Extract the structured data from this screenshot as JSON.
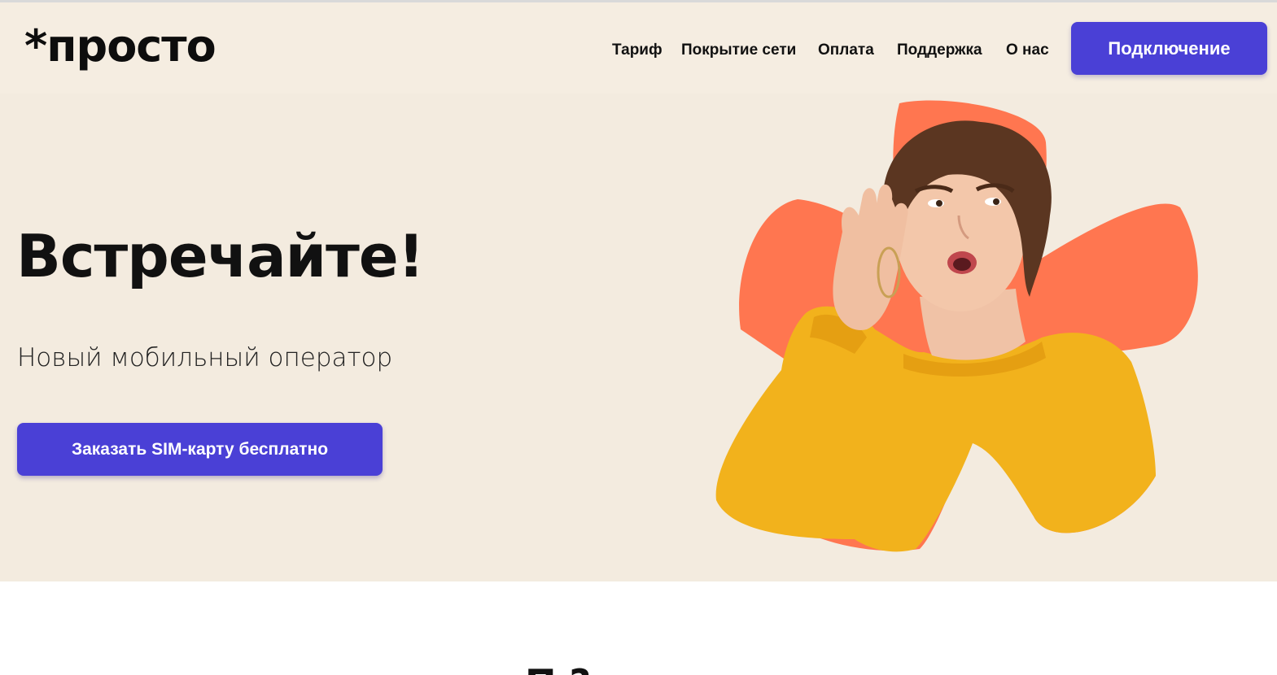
{
  "header": {
    "logo": "*просто",
    "nav": [
      {
        "label": "Тариф"
      },
      {
        "label": "Покрытие сети"
      },
      {
        "label": "Оплата"
      },
      {
        "label": "Поддержка"
      },
      {
        "label": "О нас"
      }
    ],
    "cta_label": "Подключение"
  },
  "hero": {
    "title": "Встречайте!",
    "subtitle": "Новый мобильный оператор",
    "order_button": "Заказать SIM-карту бесплатно",
    "image": "woman-listening-yellow-sweater-on-orange-asterisk"
  },
  "next_section": {
    "heading_partial": "П          ?"
  },
  "colors": {
    "header_bg": "#f5ede1",
    "hero_bg": "#f3ebdf",
    "accent": "#4a40d6",
    "asterisk": "#ff7650",
    "sweater": "#f2b21c"
  }
}
